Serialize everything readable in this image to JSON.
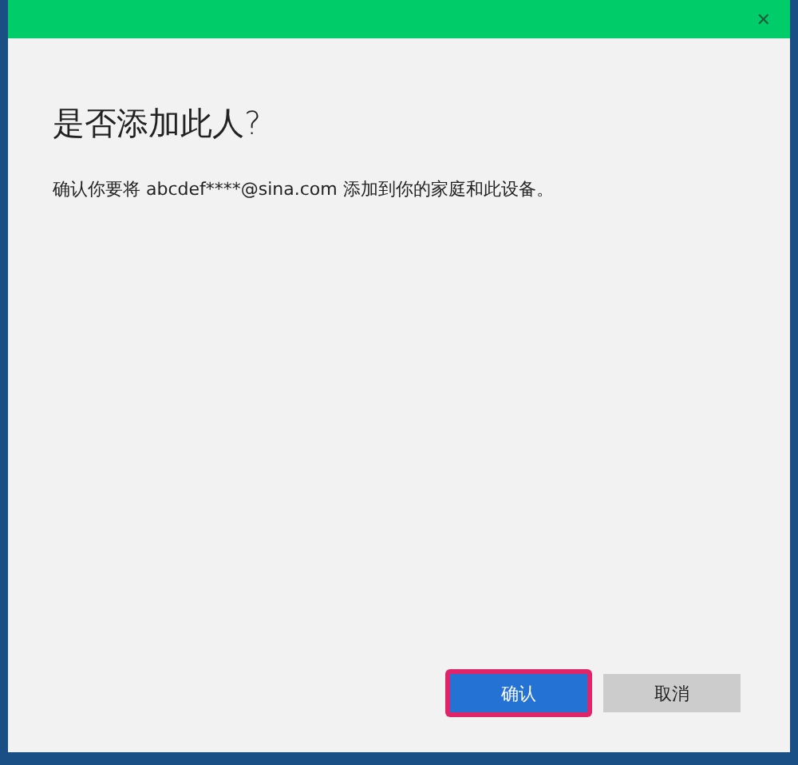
{
  "window": {
    "close_icon": "✕"
  },
  "heading": "是否添加此人?",
  "message": "确认你要将 abcdef****@sina.com 添加到你的家庭和此设备。",
  "buttons": [
    {
      "label": "确认",
      "kind": "primary",
      "highlighted": true
    },
    {
      "label": "取消",
      "kind": "secondary",
      "highlighted": false
    }
  ]
}
